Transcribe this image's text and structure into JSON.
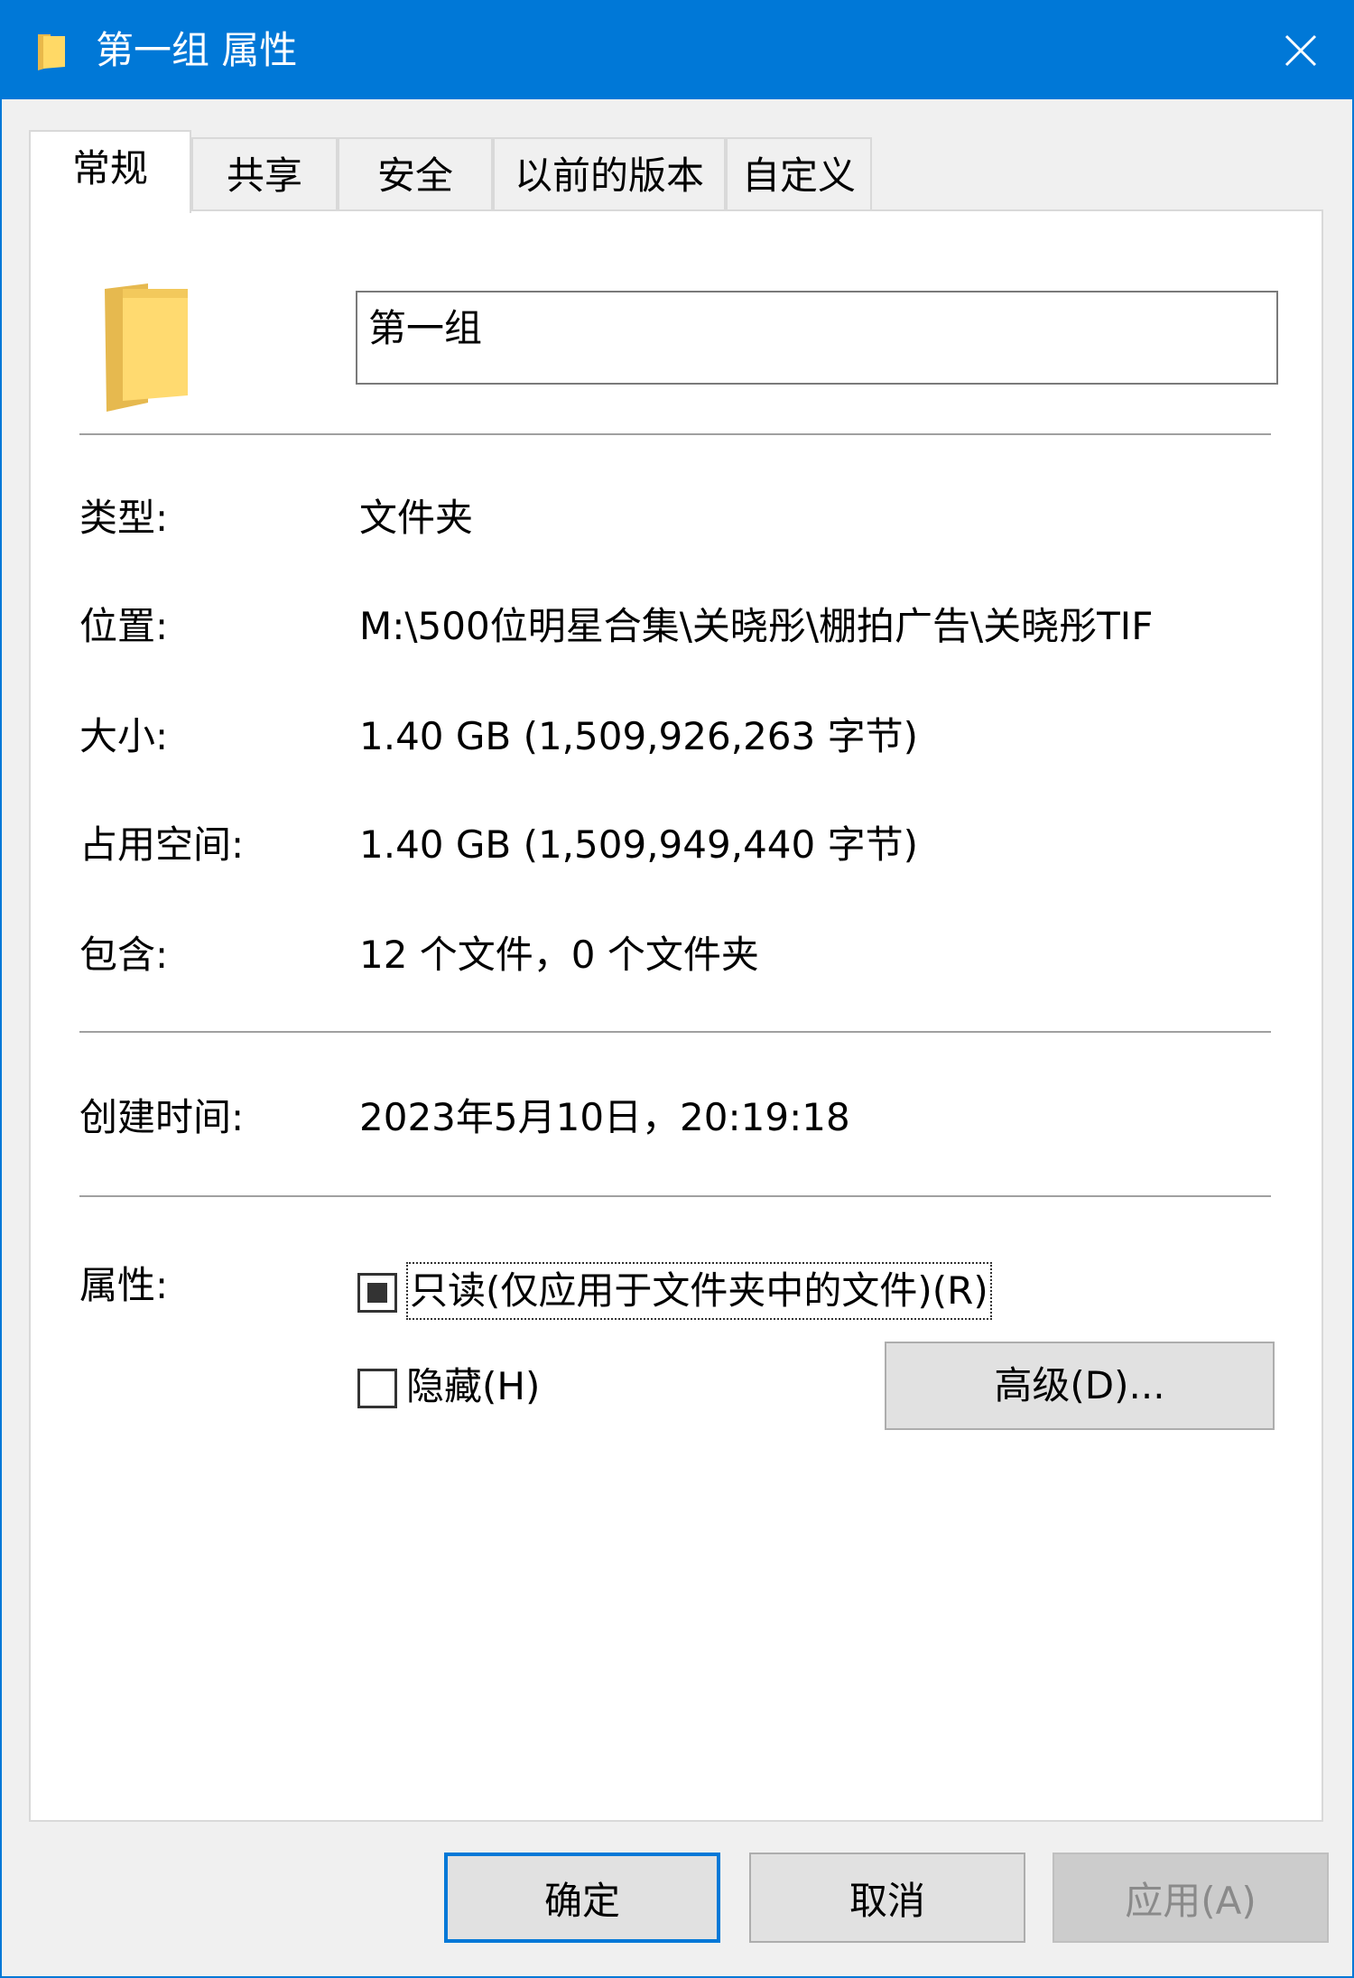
{
  "window": {
    "title": "第一组 属性"
  },
  "tabs": [
    {
      "label": "常规",
      "active": true
    },
    {
      "label": "共享"
    },
    {
      "label": "安全"
    },
    {
      "label": "以前的版本"
    },
    {
      "label": "自定义"
    }
  ],
  "general": {
    "name_value": "第一组",
    "rows": [
      {
        "label": "类型:",
        "value": "文件夹"
      },
      {
        "label": "位置:",
        "value": "M:\\500位明星合集\\关晓彤\\棚拍广告\\关晓彤TIF"
      },
      {
        "label": "大小:",
        "value": "1.40 GB (1,509,926,263 字节)"
      },
      {
        "label": "占用空间:",
        "value": "1.40 GB (1,509,949,440 字节)"
      },
      {
        "label": "包含:",
        "value": "12 个文件，0 个文件夹"
      }
    ],
    "created": {
      "label": "创建时间:",
      "value": "2023年5月10日，20:19:18"
    },
    "attributes": {
      "label": "属性:",
      "readonly_label": "只读(仅应用于文件夹中的文件)(R)",
      "hidden_label": "隐藏(H)",
      "advanced_label": "高级(D)..."
    }
  },
  "footer": {
    "ok_label": "确定",
    "cancel_label": "取消",
    "apply_label": "应用(A)"
  },
  "colors": {
    "accent": "#0078d7",
    "folder_yellow": "#f8d775"
  }
}
